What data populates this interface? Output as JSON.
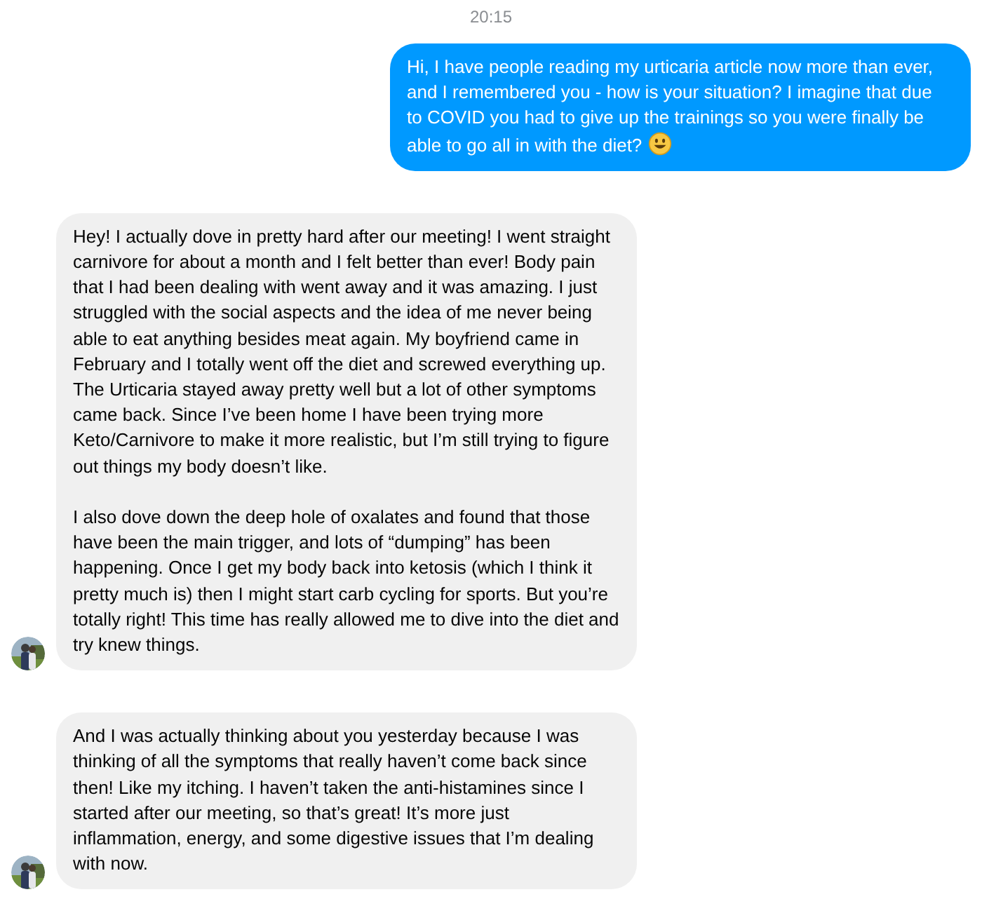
{
  "timestamp": "20:15",
  "messages": [
    {
      "kind": "sent",
      "paragraphs": [
        "Hi, I have people reading my urticaria article now more than ever, and I remembered you - how is your situation? I imagine that due to COVID you had to give up the trainings so you were finally be able to go all in with the diet?"
      ],
      "emoji_after": true
    },
    {
      "kind": "received",
      "paragraphs": [
        "Hey! I actually dove in pretty hard after our meeting! I went straight carnivore for about a month and I felt better than ever! Body pain that I had been dealing with went away and it was amazing. I just struggled with the social aspects and the idea of me never being able to eat anything besides meat again. My boyfriend came in February and I totally went off the diet and screwed everything up. The Urticaria stayed away pretty well but a lot of other symptoms came back. Since I’ve been home I have been trying more Keto/Carnivore to make it more realistic, but I’m still trying to figure out things my body doesn’t like.",
        "I also dove down the deep hole of oxalates and found that those have been the main trigger, and lots of “dumping” has been happening. Once I get my body back into ketosis (which I think it pretty much is) then I might start carb cycling for sports. But you’re totally right! This time has really allowed me to dive into the diet and try knew things."
      ],
      "emoji_after": false
    },
    {
      "kind": "received",
      "paragraphs": [
        "And I was actually thinking about you yesterday because I was thinking of all the symptoms that really haven’t come back since then! Like my itching. I haven’t taken the anti-histamines since I started after our meeting, so that’s great! It’s more just inflammation, energy, and some digestive issues that I’m dealing with now."
      ],
      "emoji_after": false
    }
  ]
}
